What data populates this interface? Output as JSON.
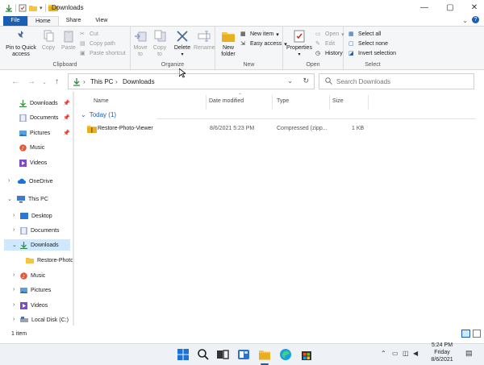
{
  "window": {
    "title": "Downloads"
  },
  "ribbon_tabs": [
    "File",
    "Home",
    "Share",
    "View"
  ],
  "ribbon": {
    "clipboard": {
      "label": "Clipboard",
      "pin": "Pin to Quick access",
      "copy": "Copy",
      "paste": "Paste",
      "cut": "Cut",
      "copy_path": "Copy path",
      "paste_shortcut": "Paste shortcut"
    },
    "organize": {
      "label": "Organize",
      "move_to": "Move to",
      "copy_to": "Copy to",
      "delete": "Delete",
      "rename": "Rename"
    },
    "new": {
      "label": "New",
      "new_folder": "New folder",
      "new_item": "New item",
      "easy_access": "Easy access"
    },
    "open": {
      "label": "Open",
      "properties": "Properties",
      "open": "Open",
      "edit": "Edit",
      "history": "History"
    },
    "select": {
      "label": "Select",
      "select_all": "Select all",
      "select_none": "Select none",
      "invert": "Invert selection"
    }
  },
  "address": {
    "crumbs": [
      "This PC",
      "Downloads"
    ],
    "search_placeholder": "Search Downloads"
  },
  "nav": {
    "quick": [
      "Downloads",
      "Documents",
      "Pictures",
      "Music",
      "Videos"
    ],
    "onedrive": "OneDrive",
    "thispc": "This PC",
    "pc_items": [
      "Desktop",
      "Documents",
      "Downloads",
      "Restore-Photo",
      "Music",
      "Pictures",
      "Videos",
      "Local Disk (C:)"
    ]
  },
  "columns": [
    "Name",
    "Date modified",
    "Type",
    "Size"
  ],
  "group": "Today (1)",
  "files": [
    {
      "name": "Restore-Photo-Viewer",
      "date": "8/6/2021 5:23 PM",
      "type": "Compressed (zipp...",
      "size": "1 KB"
    }
  ],
  "status": {
    "count": "1 item"
  },
  "taskbar": {
    "time": "5:24 PM",
    "day": "Friday",
    "date": "8/6/2021"
  },
  "colors": {
    "accent": "#1a5fb4",
    "selected": "#cde8ff",
    "folder": "#f5c542",
    "download_green": "#2e8b3a"
  }
}
